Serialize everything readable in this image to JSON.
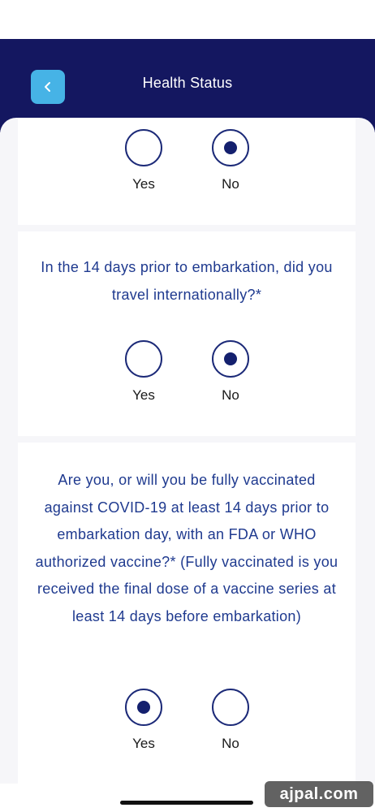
{
  "header": {
    "title": "Health Status",
    "back_icon": "chevron-left-icon",
    "background_color": "#141760",
    "back_button_color": "#46b3e6"
  },
  "questions": [
    {
      "text": "",
      "options": [
        {
          "label": "Yes",
          "selected": false
        },
        {
          "label": "No",
          "selected": true
        }
      ]
    },
    {
      "text": "In the 14 days prior to embarkation, did you travel internationally?*",
      "options": [
        {
          "label": "Yes",
          "selected": false
        },
        {
          "label": "No",
          "selected": true
        }
      ]
    },
    {
      "text": "Are you, or will you be fully vaccinated against COVID-19 at least 14 days prior to embarkation day, with an FDA or WHO authorized vaccine?* (Fully vaccinated is you received the final dose of a vaccine series at least 14 days before embarkation)",
      "options": [
        {
          "label": "Yes",
          "selected": true
        },
        {
          "label": "No",
          "selected": false
        }
      ]
    }
  ],
  "watermark": "ajpal.com",
  "colors": {
    "question_text": "#1f3a8f",
    "radio_selected": "#14206e"
  }
}
